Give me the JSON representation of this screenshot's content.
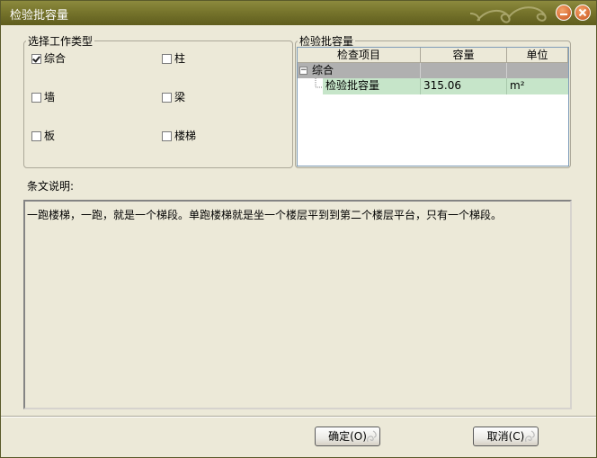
{
  "window": {
    "title": "检验批容量"
  },
  "work_type_group": {
    "legend": "选择工作类型",
    "items": [
      {
        "label": "综合",
        "checked": true
      },
      {
        "label": "柱",
        "checked": false
      },
      {
        "label": "墙",
        "checked": false
      },
      {
        "label": "梁",
        "checked": false
      },
      {
        "label": "板",
        "checked": false
      },
      {
        "label": "楼梯",
        "checked": false
      }
    ]
  },
  "capacity_group": {
    "legend": "检验批容量",
    "columns": [
      "检查项目",
      "容量",
      "单位"
    ],
    "rows": [
      {
        "item": "综合",
        "capacity": "",
        "unit": "",
        "expander": "−"
      },
      {
        "item": "检验批容量",
        "capacity": "315.06",
        "unit": "m²"
      }
    ]
  },
  "description": {
    "label": "条文说明:",
    "text": "一跑楼梯，一跑，就是一个梯段。单跑楼梯就是坐一个楼层平到到第二个楼层平台，只有一个梯段。"
  },
  "buttons": {
    "ok": "确定(O)",
    "cancel": "取消(C)"
  },
  "colors": {
    "titlebar": "#77752c",
    "grid_selected": "#c6e5c9",
    "grid_group": "#b0b0b0",
    "dialog_bg": "#ece9d8"
  }
}
